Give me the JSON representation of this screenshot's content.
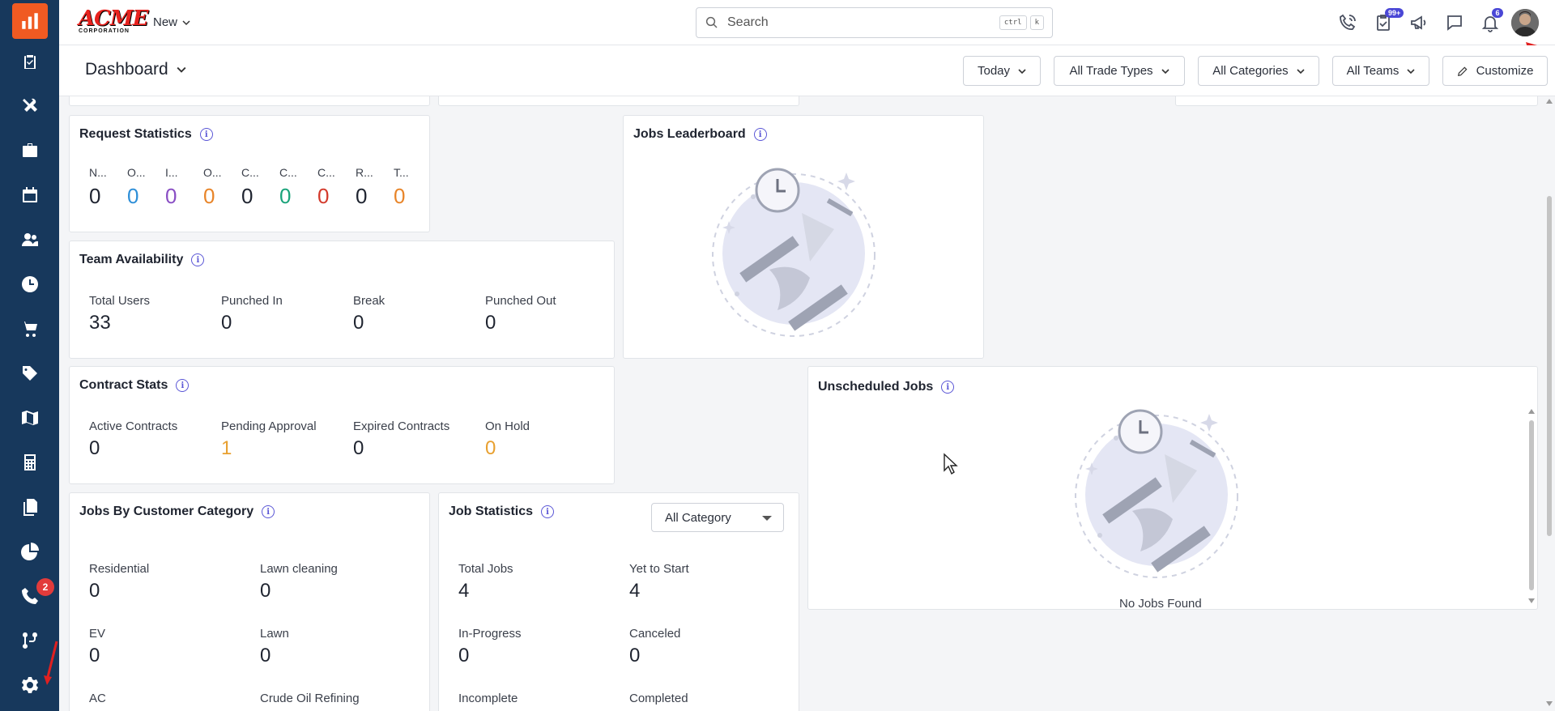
{
  "topbar": {
    "brand_name": "ACME",
    "brand_sub": "CORPORATION",
    "new_label": "New",
    "search_placeholder": "Search",
    "kbd_ctrl": "ctrl",
    "kbd_k": "k",
    "tasks_badge": "99+",
    "notifications_badge": "6"
  },
  "sidebar": {
    "calls_badge": "2",
    "items": [
      "logo-icon",
      "clipboard-icon",
      "tools-icon",
      "briefcase-icon",
      "calendar-icon",
      "users-icon",
      "clock-icon",
      "cart-icon",
      "tag-icon",
      "map-icon",
      "calculator-icon",
      "documents-icon",
      "pie-chart-icon",
      "calls-icon",
      "workflow-icon",
      "settings-icon"
    ]
  },
  "header": {
    "title": "Dashboard",
    "filters": {
      "date": "Today",
      "trade_types": "All Trade Types",
      "categories": "All Categories",
      "teams": "All Teams"
    },
    "customize": "Customize"
  },
  "request_statistics": {
    "title": "Request Statistics",
    "columns": [
      {
        "label": "N...",
        "value": "0",
        "color": "#1f2430"
      },
      {
        "label": "O...",
        "value": "0",
        "color": "#2e8fd8"
      },
      {
        "label": "I...",
        "value": "0",
        "color": "#8a4fc4"
      },
      {
        "label": "O...",
        "value": "0",
        "color": "#e8852a"
      },
      {
        "label": "C...",
        "value": "0",
        "color": "#1f2430"
      },
      {
        "label": "C...",
        "value": "0",
        "color": "#1aa37a"
      },
      {
        "label": "C...",
        "value": "0",
        "color": "#d33a2c"
      },
      {
        "label": "R...",
        "value": "0",
        "color": "#1f2430"
      },
      {
        "label": "T...",
        "value": "0",
        "color": "#e8852a"
      }
    ]
  },
  "jobs_leaderboard": {
    "title": "Jobs Leaderboard"
  },
  "team_availability": {
    "title": "Team Availability",
    "stats": [
      {
        "label": "Total Users",
        "value": "33"
      },
      {
        "label": "Punched In",
        "value": "0"
      },
      {
        "label": "Break",
        "value": "0"
      },
      {
        "label": "Punched Out",
        "value": "0"
      }
    ]
  },
  "contract_stats": {
    "title": "Contract Stats",
    "stats": [
      {
        "label": "Active Contracts",
        "value": "0",
        "color": "#1f2430"
      },
      {
        "label": "Pending Approval",
        "value": "1",
        "color": "#e8a030"
      },
      {
        "label": "Expired Contracts",
        "value": "0",
        "color": "#1f2430"
      },
      {
        "label": "On Hold",
        "value": "0",
        "color": "#e8a030"
      }
    ]
  },
  "unscheduled_jobs": {
    "title": "Unscheduled Jobs",
    "empty_text": "No Jobs Found"
  },
  "jobs_by_category": {
    "title": "Jobs By Customer Category",
    "stats": [
      {
        "label": "Residential",
        "value": "0"
      },
      {
        "label": "Lawn cleaning",
        "value": "0"
      },
      {
        "label": "EV",
        "value": "0"
      },
      {
        "label": "Lawn",
        "value": "0"
      },
      {
        "label": "AC",
        "value": ""
      },
      {
        "label": "Crude Oil Refining",
        "value": ""
      }
    ]
  },
  "job_statistics": {
    "title": "Job Statistics",
    "category_select": "All Category",
    "stats": [
      {
        "label": "Total Jobs",
        "value": "4"
      },
      {
        "label": "Yet to Start",
        "value": "4"
      },
      {
        "label": "In-Progress",
        "value": "0"
      },
      {
        "label": "Canceled",
        "value": "0"
      },
      {
        "label": "Incomplete",
        "value": ""
      },
      {
        "label": "Completed",
        "value": ""
      }
    ]
  },
  "colors": {
    "sidebar": "#17385c",
    "accent": "#f05a22",
    "info": "#5a56d6"
  }
}
